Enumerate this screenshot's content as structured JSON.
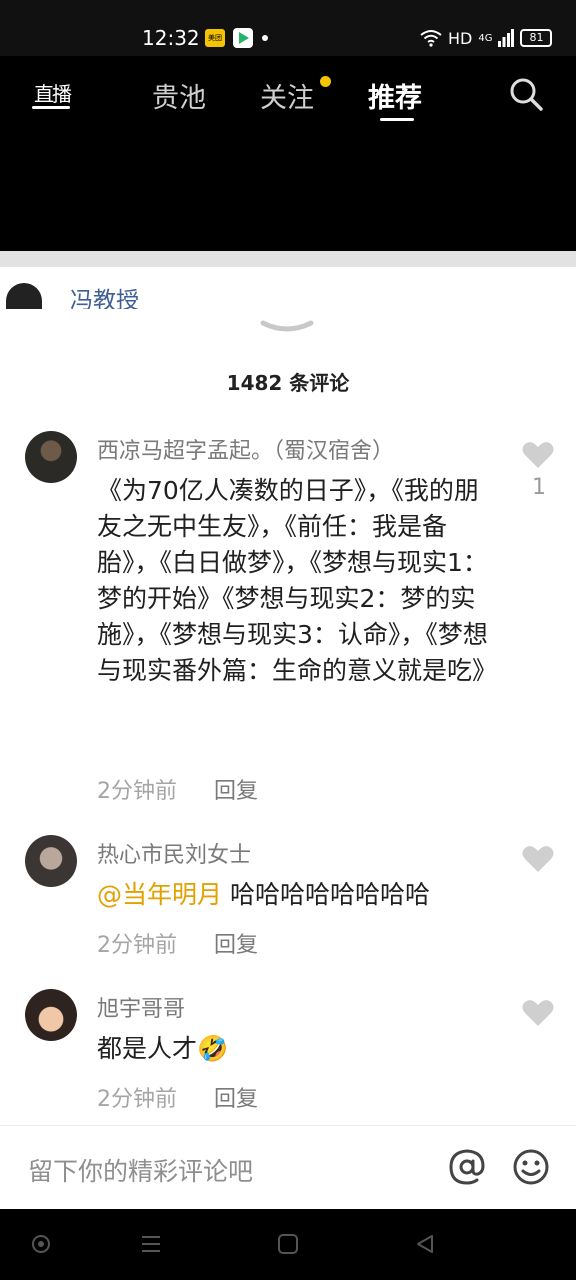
{
  "status_bar": {
    "time": "12:32",
    "network": "HD",
    "signal_type": "4G",
    "battery": "81"
  },
  "top_nav": {
    "live_label": "直播",
    "tabs": [
      {
        "label": "贵池",
        "active": false
      },
      {
        "label": "关注",
        "active": false,
        "has_dot": true
      },
      {
        "label": "推荐",
        "active": true
      }
    ],
    "search_icon": "search-icon"
  },
  "author": {
    "name": "冯教授"
  },
  "comments_panel": {
    "count_label": "1482 条评论",
    "comments": [
      {
        "username": "西凉马超字孟起。（蜀汉宿舍）",
        "text": "《为70亿人凑数的日子》，《我的朋友之无中生友》，《前任：我是备胎》，《白日做梦》，《梦想与现实1：梦的开始》《梦想与现实2：梦的实施》，《梦想与现实3：认命》，《梦想与现实番外篇：生命的意义就是吃》",
        "time": "2分钟前",
        "reply_label": "回复",
        "likes": "1"
      },
      {
        "username": "热心市民刘女士",
        "mention": "@当年明月",
        "text": " 哈哈哈哈哈哈哈哈",
        "time": "2分钟前",
        "reply_label": "回复"
      },
      {
        "username": "旭宇哥哥",
        "text": "都是人才",
        "emoji": "🤣",
        "time": "2分钟前",
        "reply_label": "回复"
      }
    ]
  },
  "input_bar": {
    "placeholder": "留下你的精彩评论吧"
  },
  "colors": {
    "mention": "#e2a100",
    "author_name": "#3f5e96",
    "follow_dot": "#f5c400"
  }
}
